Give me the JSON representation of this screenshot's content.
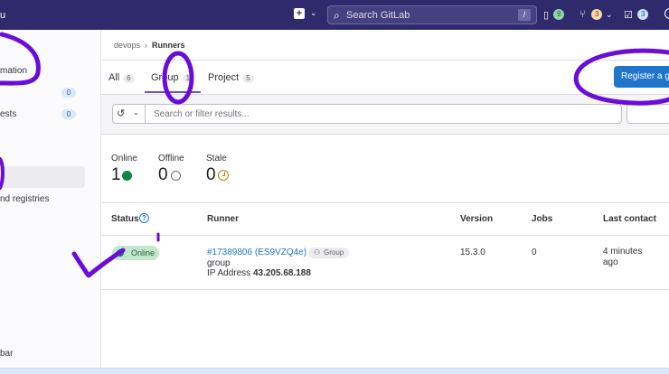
{
  "topbar": {
    "brand": "u",
    "search_placeholder": "Search GitLab",
    "search_shortcut": "/",
    "issues_count": "9",
    "merge_requests_count": "3",
    "todos_count": "3"
  },
  "sidebar": {
    "items": [
      {
        "label": "mation"
      },
      {
        "label": "",
        "count": "0"
      },
      {
        "label": "ests",
        "count": "0"
      },
      {
        "label": "nd registries"
      },
      {
        "label": "bar"
      }
    ]
  },
  "breadcrumb": {
    "parent": "devops",
    "current": "Runners"
  },
  "tabs": [
    {
      "label": "All",
      "count": "6"
    },
    {
      "label": "Group",
      "count": "1"
    },
    {
      "label": "Project",
      "count": "5"
    }
  ],
  "register_button": "Register a g",
  "filter": {
    "placeholder": "Search or filter results..."
  },
  "stats": {
    "online": {
      "label": "Online",
      "value": "1"
    },
    "offline": {
      "label": "Offline",
      "value": "0"
    },
    "stale": {
      "label": "Stale",
      "value": "0"
    }
  },
  "table": {
    "headers": [
      "Status",
      "Runner",
      "Version",
      "Jobs",
      "Last contact"
    ],
    "rows": [
      {
        "status": "Online",
        "runner_id": "#17389806 (ES9VZQ4e)",
        "runner_type": "Group",
        "description": "group",
        "ip_label": "IP Address",
        "ip": "43.205.68.188",
        "version": "15.3.0",
        "jobs": "0",
        "last_contact": "4 minutes ago"
      }
    ]
  },
  "colors": {
    "topbar": "#2f2a6b",
    "primary": "#1f75cb",
    "success": "#108548",
    "annotation": "#6a0dd8"
  }
}
